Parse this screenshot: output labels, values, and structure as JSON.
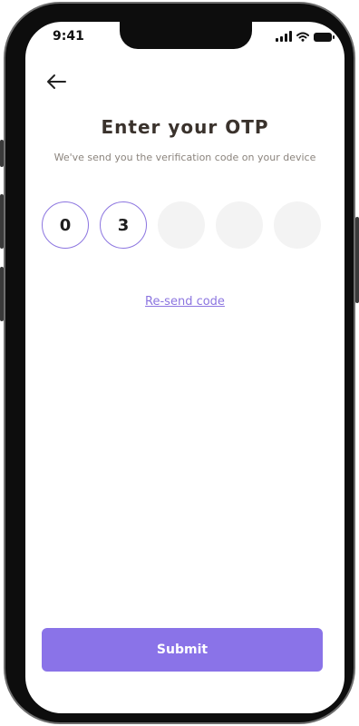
{
  "status_bar": {
    "time": "9:41",
    "icons": [
      "signal-icon",
      "wifi-icon",
      "battery-icon"
    ]
  },
  "header": {
    "back_icon": "arrow-left-icon"
  },
  "otp": {
    "title": "Enter your OTP",
    "subtitle": "We've send you the verification code on your device",
    "digits": [
      "0",
      "3",
      "",
      "",
      ""
    ],
    "resend_label": "Re-send code"
  },
  "footer": {
    "submit_label": "Submit"
  },
  "colors": {
    "accent": "#8a73e8",
    "title": "#3a322c",
    "subtitle": "#8b847d",
    "empty_box": "#f3f3f3"
  }
}
